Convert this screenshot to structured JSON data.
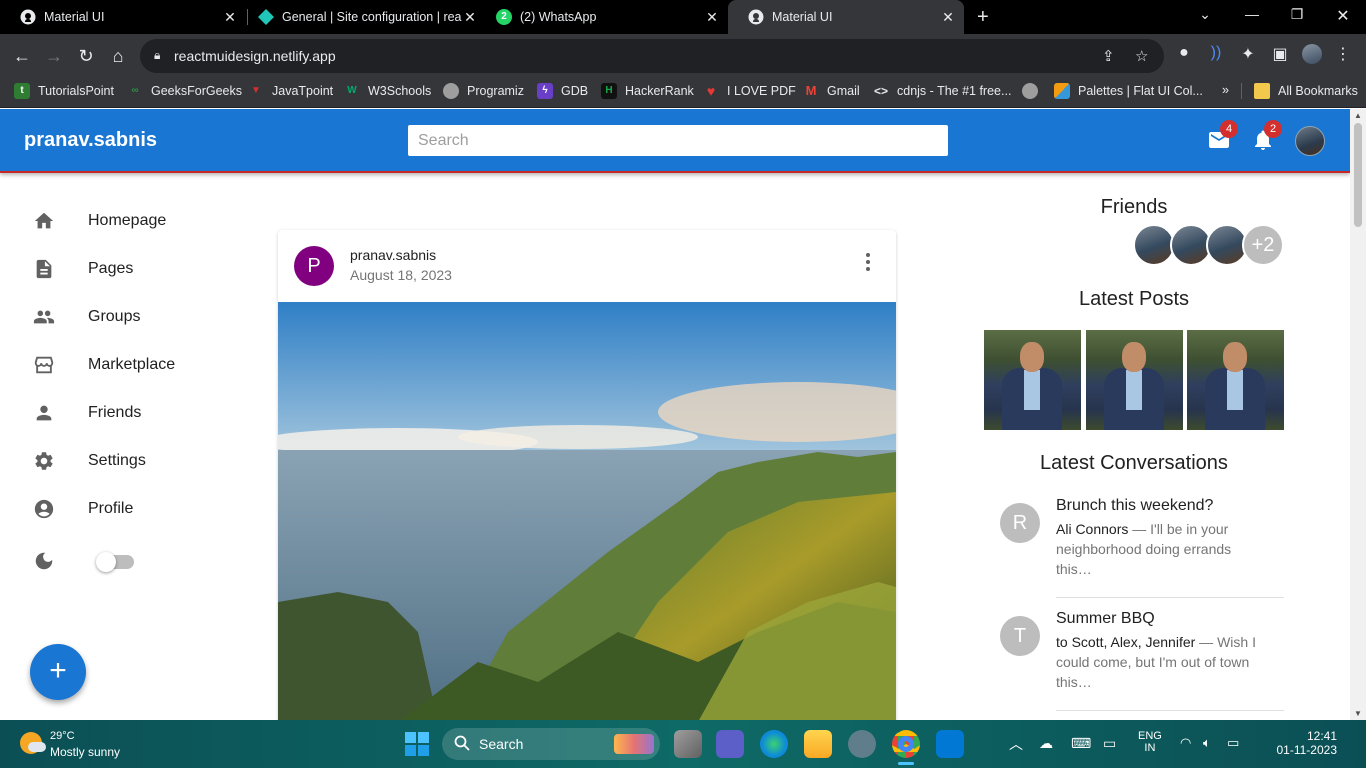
{
  "browser": {
    "tabs": [
      {
        "title": "Material UI",
        "active": false
      },
      {
        "title": "General | Site configuration | rea",
        "active": false
      },
      {
        "title": "(2) WhatsApp",
        "active": false
      },
      {
        "title": "Material UI",
        "active": true
      }
    ],
    "whatsapp_badge": "2",
    "url": "reactmuidesign.netlify.app",
    "bookmarks": [
      {
        "label": "TutorialsPoint",
        "color": "#2e7d32"
      },
      {
        "label": "GeeksForGeeks",
        "color": "#2f8d46"
      },
      {
        "label": "JavaTpoint",
        "color": "#d32f2f"
      },
      {
        "label": "W3Schools",
        "color": "#04aa6d"
      },
      {
        "label": "Programiz",
        "color": "#9e9e9e"
      },
      {
        "label": "GDB",
        "color": "#6a3fc8"
      },
      {
        "label": "HackerRank",
        "color": "#1ba94c"
      },
      {
        "label": "I LOVE PDF",
        "color": "#e53935"
      },
      {
        "label": "Gmail",
        "color": "#ea4335"
      },
      {
        "label": "cdnjs - The #1 free...",
        "color": "#e8eaed"
      },
      {
        "label": "",
        "color": "#9e9e9e"
      },
      {
        "label": "Palettes | Flat UI Col...",
        "color": "#f39c12"
      }
    ],
    "overflow_label": "»",
    "all_bookmarks": "All Bookmarks"
  },
  "app": {
    "brand": "pranav.sabnis",
    "search_placeholder": "Search",
    "mail_badge": "4",
    "notif_badge": "2",
    "accent": "#1976d2",
    "sidebar": [
      {
        "label": "Homepage",
        "icon": "home-icon"
      },
      {
        "label": "Pages",
        "icon": "article-icon"
      },
      {
        "label": "Groups",
        "icon": "group-icon"
      },
      {
        "label": "Marketplace",
        "icon": "storefront-icon"
      },
      {
        "label": "Friends",
        "icon": "person-icon"
      },
      {
        "label": "Settings",
        "icon": "settings-icon"
      },
      {
        "label": "Profile",
        "icon": "account-circle-icon"
      }
    ],
    "fab_label": "+",
    "post": {
      "avatar_letter": "P",
      "author": "pranav.sabnis",
      "date": "August 18, 2023"
    },
    "rightbar": {
      "friends_title": "Friends",
      "friends_more": "+2",
      "latest_posts_title": "Latest Posts",
      "conversations_title": "Latest Conversations",
      "conversations": [
        {
          "letter": "R",
          "title": "Brunch this weekend?",
          "sender": "Ali Connors",
          "text": " — I'll be in your neighborhood doing errands this…"
        },
        {
          "letter": "T",
          "title": "Summer BBQ",
          "sender": "to Scott, Alex, Jennifer",
          "text": " — Wish I could come, but I'm out of town this…"
        }
      ]
    }
  },
  "taskbar": {
    "temperature": "29°C",
    "condition": "Mostly sunny",
    "search_label": "Search",
    "lang_top": "ENG",
    "lang_bottom": "IN",
    "time": "12:41",
    "date": "01-11-2023"
  }
}
